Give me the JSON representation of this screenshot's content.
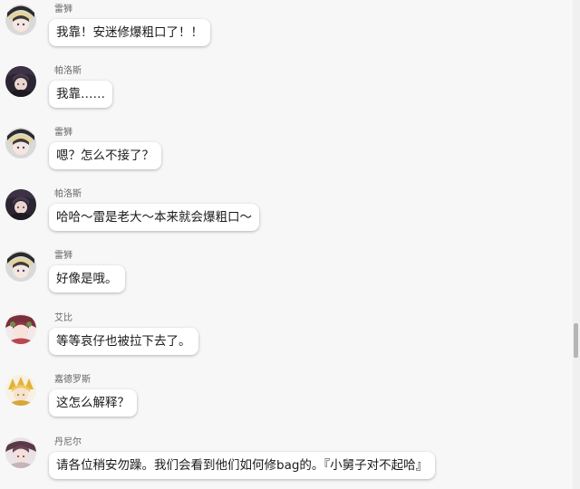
{
  "messages": [
    {
      "sender": "雷狮",
      "text": "我靠！安迷修爆粗口了！！",
      "avatar": "leishi-avatar"
    },
    {
      "sender": "帕洛斯",
      "text": "我靠……",
      "avatar": "palos-avatar"
    },
    {
      "sender": "雷狮",
      "text": "嗯？怎么不接了？",
      "avatar": "leishi-avatar"
    },
    {
      "sender": "帕洛斯",
      "text": "哈哈～雷是老大～本来就会爆粗口～",
      "avatar": "palos-avatar"
    },
    {
      "sender": "雷狮",
      "text": "好像是哦。",
      "avatar": "leishi-avatar"
    },
    {
      "sender": "艾比",
      "text": "等等哀仔也被拉下去了。",
      "avatar": "aibi-avatar"
    },
    {
      "sender": "嘉德罗斯",
      "text": "这怎么解释？",
      "avatar": "jiadeluosi-avatar"
    },
    {
      "sender": "丹尼尔",
      "text": "请各位稍安勿躁。我们会看到他们如何修bag的。『小舅子对不起哈』",
      "avatar": "danier-avatar"
    }
  ],
  "colors": {
    "background": "#f7f7f7",
    "bubble": "#ffffff",
    "sender_name": "#666666",
    "text": "#1a1a1a"
  }
}
